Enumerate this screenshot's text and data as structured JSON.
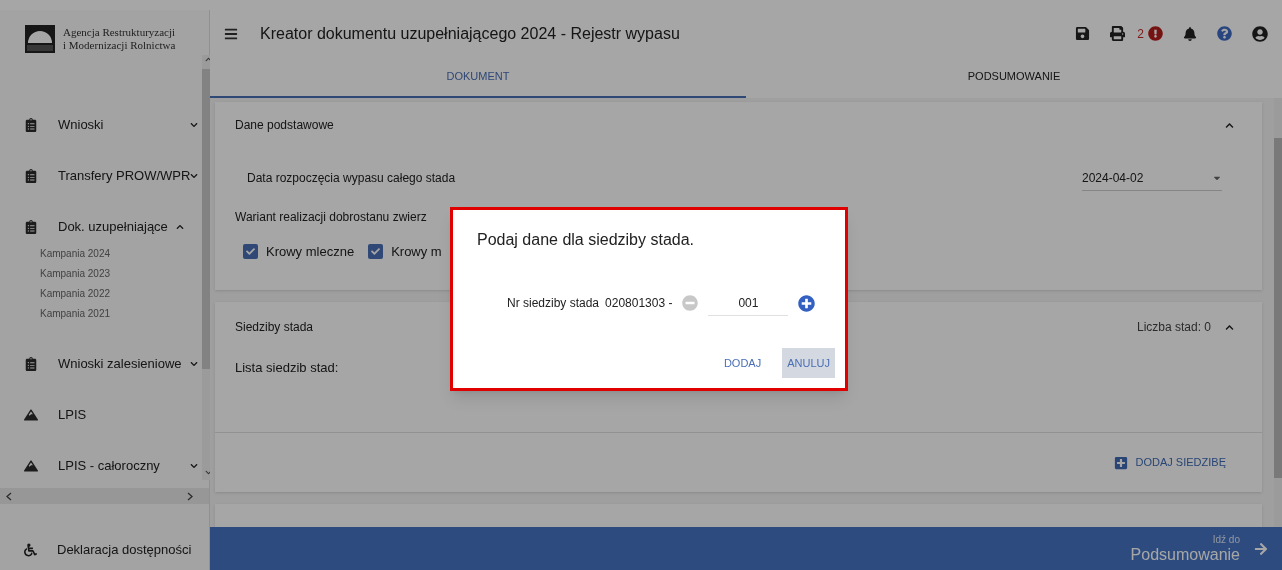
{
  "sidebar": {
    "logo_lines": [
      "Agencja Restrukturyzacji",
      "i Modernizacji Rolnictwa"
    ],
    "items": [
      {
        "label": "Wnioski",
        "kind": "clipboard",
        "expanded": false
      },
      {
        "label": "Transfery PROW/WPR",
        "kind": "clipboard",
        "expanded": false
      },
      {
        "label": "Dok. uzupełniające",
        "kind": "clipboard",
        "expanded": true,
        "children": [
          {
            "label": "Kampania 2024"
          },
          {
            "label": "Kampania 2023"
          },
          {
            "label": "Kampania 2022"
          },
          {
            "label": "Kampania 2021"
          }
        ]
      },
      {
        "label": "Wnioski zalesieniowe",
        "kind": "clipboard",
        "expanded": false
      },
      {
        "label": "LPIS",
        "kind": "map"
      },
      {
        "label": "LPIS - całoroczny",
        "kind": "map",
        "expanded": false
      }
    ],
    "footer_item": {
      "label": "Deklaracja dostępności"
    }
  },
  "header": {
    "title": "Kreator dokumentu uzupełniającego 2024 - Rejestr wypasu",
    "error_count": "2"
  },
  "tabs": [
    {
      "label": "DOKUMENT",
      "selected": true
    },
    {
      "label": "PODSUMOWANIE",
      "selected": false
    }
  ],
  "basic": {
    "title": "Dane podstawowe",
    "date_label": "Data rozpoczęcia wypasu całego stada",
    "date_value": "2024-04-02",
    "variant_label": "Wariant realizacji dobrostanu zwierz",
    "checkboxes": [
      {
        "label": "Krowy mleczne",
        "checked": true
      },
      {
        "label": "Krowy m",
        "checked": true
      }
    ]
  },
  "herds": {
    "title": "Siedziby stada",
    "count": "Liczba stad: 0",
    "list_label": "Lista siedzib stad:",
    "add_button": "DODAJ SIEDZIBĘ"
  },
  "bottom_bar": {
    "caption": "Idź do",
    "target": "Podsumowanie"
  },
  "dialog": {
    "title": "Podaj dane dla siedziby stada.",
    "field_label": "Nr siedziby stada",
    "prefix": "020801303 -",
    "value": "001",
    "buttons": [
      {
        "label": "DODAJ",
        "focused": false
      },
      {
        "label": "ANULUJ",
        "focused": true
      }
    ]
  }
}
